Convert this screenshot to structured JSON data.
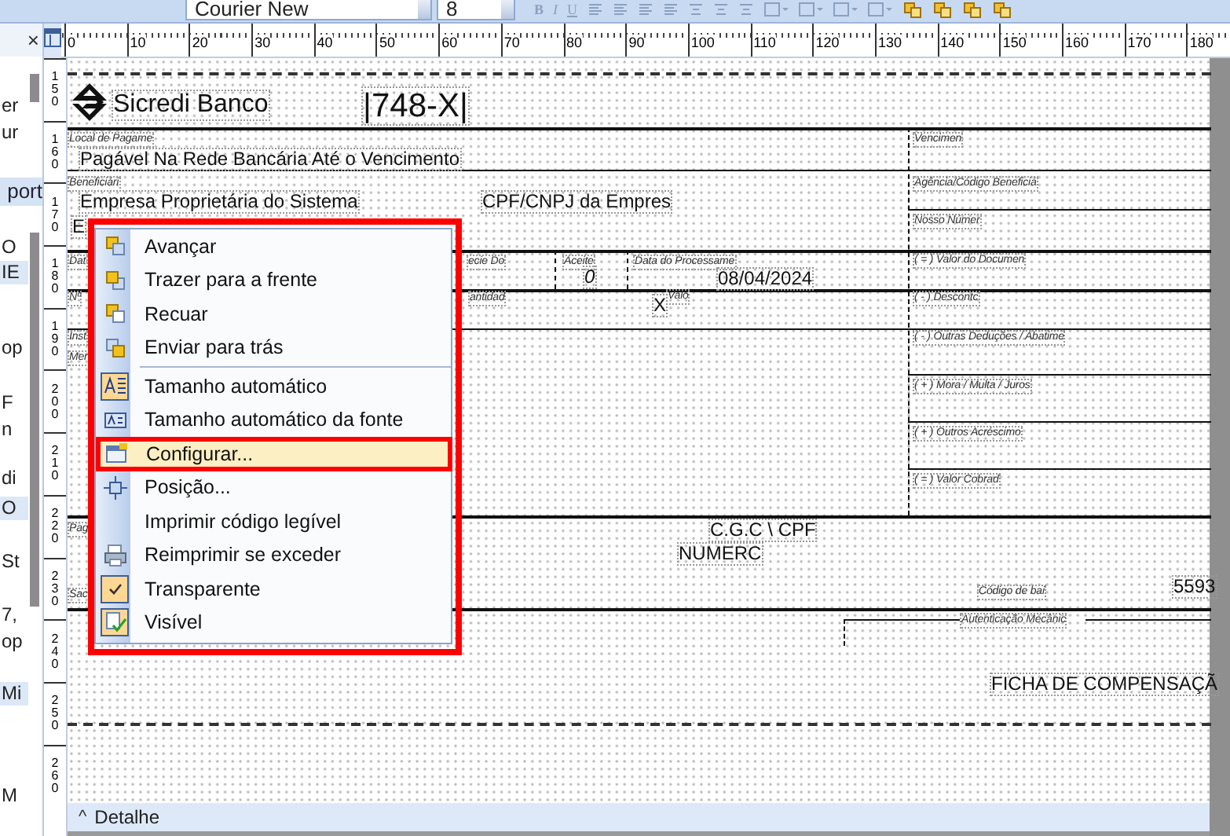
{
  "toolbar": {
    "font": "Courier New",
    "size": "8",
    "format_buttons": [
      "B",
      "I",
      "U"
    ]
  },
  "left_panel": {
    "close": "×",
    "header": "port",
    "fragments": [
      {
        "text": "er",
        "selected": false
      },
      {
        "text": "ur",
        "selected": false
      },
      {
        "text": "O",
        "selected": false
      },
      {
        "text": "IE",
        "selected": false
      },
      {
        "text": "op",
        "selected": false
      },
      {
        "text": "F",
        "selected": false
      },
      {
        "text": "n",
        "selected": false
      },
      {
        "text": "di",
        "selected": false
      },
      {
        "text": "O",
        "selected": false
      },
      {
        "text": "St",
        "selected": false
      },
      {
        "text": "7,",
        "selected": false
      },
      {
        "text": "op",
        "selected": false
      },
      {
        "text": "Mi",
        "selected": false
      },
      {
        "text": "M",
        "selected": false
      }
    ]
  },
  "rulers": {
    "horizontal": [
      "0",
      "10",
      "20",
      "30",
      "40",
      "50",
      "60",
      "70",
      "80",
      "90",
      "100",
      "110",
      "120",
      "130",
      "140",
      "150",
      "160",
      "170",
      "180"
    ],
    "vertical": [
      "150",
      "160",
      "170",
      "180",
      "190",
      "200",
      "210",
      "220",
      "230",
      "240",
      "250",
      "260"
    ]
  },
  "report": {
    "fields": [
      {
        "kind": "title",
        "text": "Sicredi Banco"
      },
      {
        "kind": "code",
        "text": "|748-X|"
      },
      {
        "kind": "label",
        "text": "Local de Pagame"
      },
      {
        "kind": "label",
        "text": "Vencimen"
      },
      {
        "kind": "value",
        "text": "Pagável Na Rede Bancária Até o Vencimento"
      },
      {
        "kind": "label",
        "text": "Beneficiári"
      },
      {
        "kind": "label",
        "text": "Agência/Código Beneficiá"
      },
      {
        "kind": "value",
        "text": "Empresa Proprietária do Sistema"
      },
      {
        "kind": "value",
        "text": "CPF/CNPJ da Empres"
      },
      {
        "kind": "label",
        "text": "Nosso Númer"
      },
      {
        "kind": "value",
        "text": "E"
      },
      {
        "kind": "label",
        "text": "Dat"
      },
      {
        "kind": "label",
        "text": "ecie Do"
      },
      {
        "kind": "label",
        "text": "Aceite"
      },
      {
        "kind": "italic",
        "text": "0"
      },
      {
        "kind": "label",
        "text": "Data do Processame"
      },
      {
        "kind": "value",
        "text": "08/04/2024"
      },
      {
        "kind": "label",
        "text": "( = ) Valor do Documen"
      },
      {
        "kind": "label",
        "text": "Nº"
      },
      {
        "kind": "label",
        "text": "antidad"
      },
      {
        "kind": "value",
        "text": "X"
      },
      {
        "kind": "label",
        "text": "Valo"
      },
      {
        "kind": "label",
        "text": "( - ) Descontc"
      },
      {
        "kind": "label",
        "text": "Inst"
      },
      {
        "kind": "label",
        "text": "Mer"
      },
      {
        "kind": "label",
        "text": "( - ) Outras Deduções / Abatime"
      },
      {
        "kind": "label",
        "text": "( + ) Mora / Multa / Juros"
      },
      {
        "kind": "label",
        "text": "( + ) Outros Acréscimo"
      },
      {
        "kind": "label",
        "text": "( = ) Valor Cobrad"
      },
      {
        "kind": "label",
        "text": "Pag"
      },
      {
        "kind": "value",
        "text": "C.G.C \\ CPF"
      },
      {
        "kind": "value",
        "text": "NUMERC"
      },
      {
        "kind": "label",
        "text": "Sac"
      },
      {
        "kind": "label",
        "text": "Código de bai"
      },
      {
        "kind": "value",
        "text": "5593"
      },
      {
        "kind": "label",
        "text": "Autenticação Mecânic"
      },
      {
        "kind": "value",
        "text": "FICHA DE COMPENSAÇÃ"
      }
    ]
  },
  "context_menu": {
    "outlined": true,
    "items": [
      {
        "kind": "item",
        "label": "Avançar",
        "checked": false,
        "selected": false,
        "outlined": false
      },
      {
        "kind": "item",
        "label": "Trazer para a frente",
        "checked": false,
        "selected": false,
        "outlined": false
      },
      {
        "kind": "item",
        "label": "Recuar",
        "checked": false,
        "selected": false,
        "outlined": false
      },
      {
        "kind": "item",
        "label": "Enviar para trás",
        "checked": false,
        "selected": false,
        "outlined": false
      },
      {
        "kind": "separator"
      },
      {
        "kind": "item",
        "label": "Tamanho automático",
        "checked": true,
        "selected": false,
        "outlined": false
      },
      {
        "kind": "item",
        "label": "Tamanho automático da fonte",
        "checked": false,
        "selected": false,
        "outlined": false
      },
      {
        "kind": "item",
        "label": "Configurar...",
        "checked": false,
        "selected": true,
        "outlined": true
      },
      {
        "kind": "item",
        "label": "Posição...",
        "checked": false,
        "selected": false,
        "outlined": false
      },
      {
        "kind": "item",
        "label": "Imprimir código legível",
        "checked": false,
        "selected": false,
        "outlined": false
      },
      {
        "kind": "item",
        "label": "Reimprimir se exceder",
        "checked": false,
        "selected": false,
        "outlined": false
      },
      {
        "kind": "item",
        "label": "Transparente",
        "checked": true,
        "selected": false,
        "outlined": false
      },
      {
        "kind": "item",
        "label": "Visível",
        "checked": true,
        "selected": false,
        "outlined": false
      }
    ]
  },
  "band": {
    "caret": "^",
    "title": "Detalhe"
  }
}
